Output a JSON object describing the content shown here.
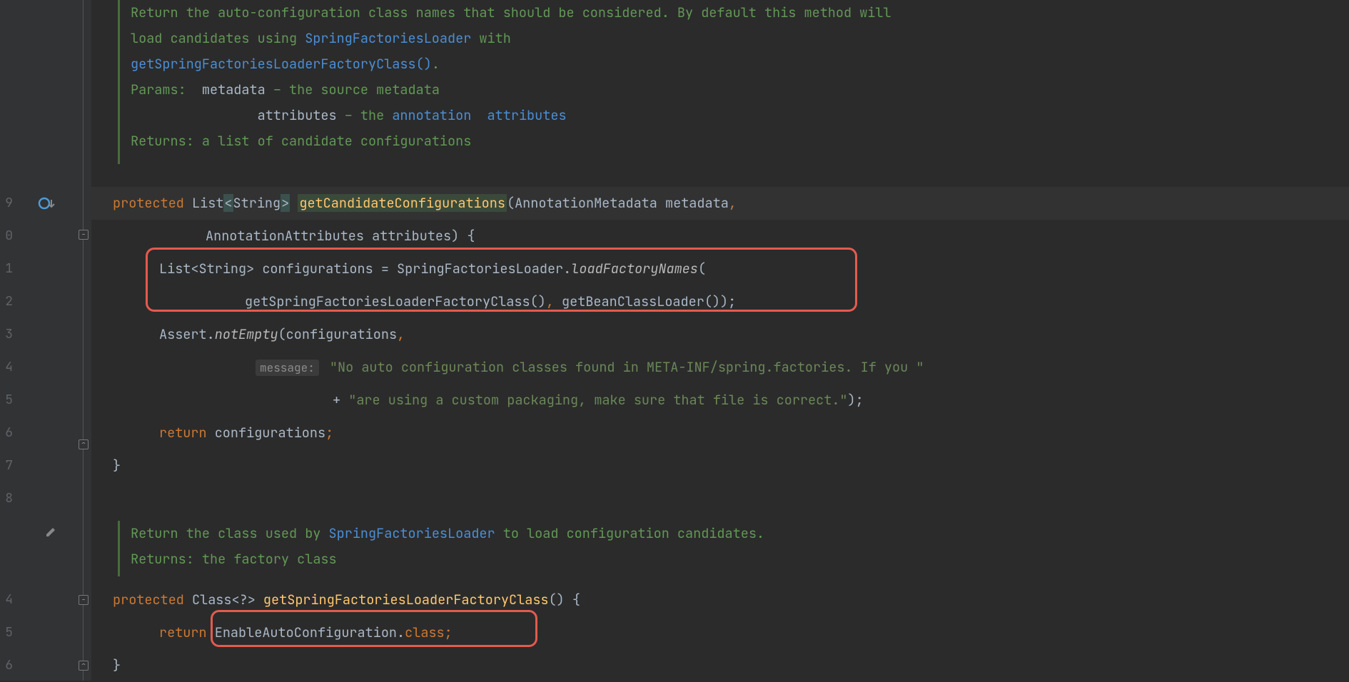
{
  "doc1": {
    "line1_a": "Return the auto-configuration class names that should be considered. By default this method will",
    "line2_a": "load candidates using ",
    "line2_link1": "SpringFactoriesLoader",
    "line2_b": " with",
    "line3_link": "getSpringFactoriesLoaderFactoryClass()",
    "line3_b": ".",
    "params_label": "Params:",
    "param1_name": "metadata",
    "param1_dash": " – the source metadata",
    "param2_name": "attributes",
    "param2_dash": " – the ",
    "param2_link1": "annotation",
    "param2_space": "  ",
    "param2_link2": "attributes",
    "returns_label": "Returns:",
    "returns_text": " a list of candidate configurations"
  },
  "lines": {
    "l9_protected": "protected",
    "l9_list": "List",
    "l9_lt": "<",
    "l9_string": "String",
    "l9_gt": ">",
    "l9_method": "getCandidateConfigurations",
    "l9_paren": "(",
    "l9_ptype1": "AnnotationMetadata",
    "l9_pname1": " metadata",
    "l9_comma": ",",
    "l10_ptype2": "AnnotationAttributes",
    "l10_pname2": " attributes",
    "l10_close": ") {",
    "l11_a": "List<String> configurations = SpringFactoriesLoader.",
    "l11_list": "List",
    "l11_string": "String",
    "l11_conf": " configurations ",
    "l11_eq": "=",
    "l11_sfl": " SpringFactoriesLoader",
    "l11_dot": ".",
    "l11_method": "loadFactoryNames",
    "l11_paren": "(",
    "l12_m1": "getSpringFactoriesLoaderFactoryClass",
    "l12_p1": "()",
    "l12_comma": ", ",
    "l12_m2": "getBeanClassLoader",
    "l12_p2": "());",
    "l13_assert": "Assert",
    "l13_dot": ".",
    "l13_ne": "notEmpty",
    "l13_paren": "(",
    "l13_conf": "configurations",
    "l13_comma": ",",
    "l14_hint": "message:",
    "l14_str": "\"No auto configuration classes found in META-INF/spring.factories. If you \"",
    "l15_plus": "+",
    "l15_str": "\"are using a custom packaging, make sure that file is correct.\"",
    "l15_close": ");",
    "l16_return": "return",
    "l16_conf": " configurations",
    "l16_semi": ";",
    "l17_brace": "}"
  },
  "doc2": {
    "line1_a": "Return the class used by ",
    "line1_link": "SpringFactoriesLoader",
    "line1_b": " to load configuration candidates.",
    "returns_label": "Returns:",
    "returns_text": " the factory class"
  },
  "lines2": {
    "l24_protected": "protected",
    "l24_class": " Class",
    "l24_gen": "<?>",
    "l24_method": " getSpringFactoriesLoaderFactoryClass",
    "l24_close": "() {",
    "l25_return": "return",
    "l25_sp": " ",
    "l25_type": "EnableAutoConfiguration",
    "l25_dot": ".",
    "l25_class": "class",
    "l25_semi": ";",
    "l26_brace": "}"
  },
  "gutter": {
    "line_numbers": [
      "9",
      "0",
      "1",
      "2",
      "3",
      "4",
      "5",
      "6",
      "7",
      "8",
      "",
      "",
      "4",
      "5",
      "6"
    ]
  }
}
